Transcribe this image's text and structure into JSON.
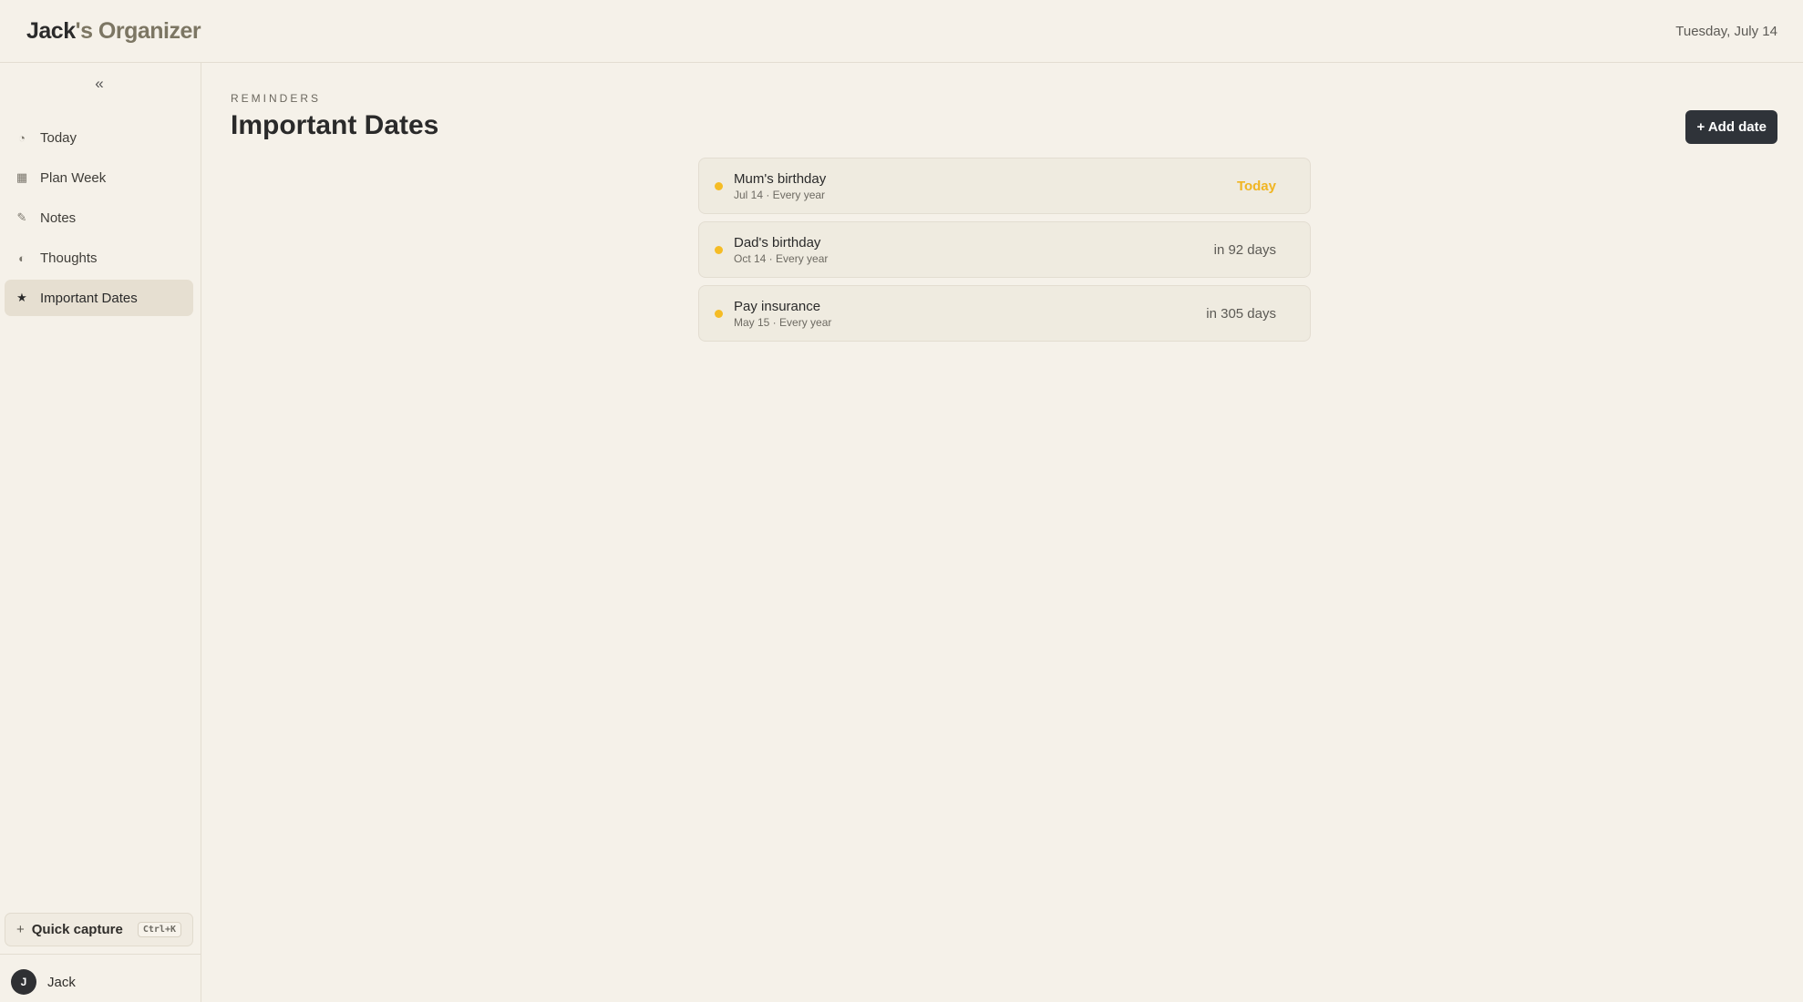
{
  "app": {
    "brand_owner": "Jack",
    "brand_rest": "'s Organizer",
    "current_date": "Tuesday, July 14"
  },
  "sidebar": {
    "collapse_label": "«",
    "items": [
      {
        "label": "Today",
        "icon": "clock-icon",
        "glyph": "◔",
        "active": false
      },
      {
        "label": "Plan Week",
        "icon": "calendar-grid-icon",
        "glyph": "▦",
        "active": false
      },
      {
        "label": "Notes",
        "icon": "pencil-icon",
        "glyph": "✎",
        "active": false
      },
      {
        "label": "Thoughts",
        "icon": "half-circle-icon",
        "glyph": "◐",
        "active": false
      },
      {
        "label": "Important Dates",
        "icon": "star-icon",
        "glyph": "★",
        "active": true
      }
    ],
    "quick_capture": {
      "plus": "+",
      "label": "Quick capture",
      "shortcut": "Ctrl+K"
    },
    "user": {
      "initial": "J",
      "name": "Jack"
    }
  },
  "main": {
    "eyebrow": "REMINDERS",
    "title": "Important Dates",
    "add_button": "+ Add date",
    "dates": [
      {
        "title": "Mum's birthday",
        "subtitle": "Jul 14 · Every year",
        "when": "Today",
        "is_today": true
      },
      {
        "title": "Dad's birthday",
        "subtitle": "Oct 14 · Every year",
        "when": "in 92 days",
        "is_today": false
      },
      {
        "title": "Pay insurance",
        "subtitle": "May 15 · Every year",
        "when": "in 305 days",
        "is_today": false
      }
    ]
  },
  "colors": {
    "background": "#f5f1e9",
    "accent_dot": "#f5bc25",
    "today_text": "#f0b522",
    "button_bg": "#2f3339"
  }
}
